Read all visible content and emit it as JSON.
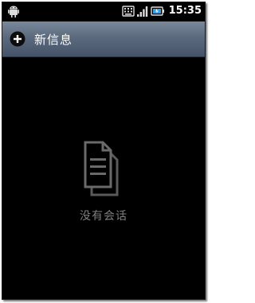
{
  "status_bar": {
    "time": "15:35",
    "icons": [
      "android-icon",
      "keyboard-icon",
      "signal-icon",
      "battery-icon"
    ]
  },
  "action_bar": {
    "new_message_label": "新信息",
    "icon": "plus-icon"
  },
  "empty_state": {
    "icon": "document-icon",
    "text": "没有会话"
  },
  "colors": {
    "background": "#000000",
    "action_bar_top": "#7a889a",
    "action_bar_bottom": "#45536a",
    "empty_text": "#7f7f7f"
  }
}
